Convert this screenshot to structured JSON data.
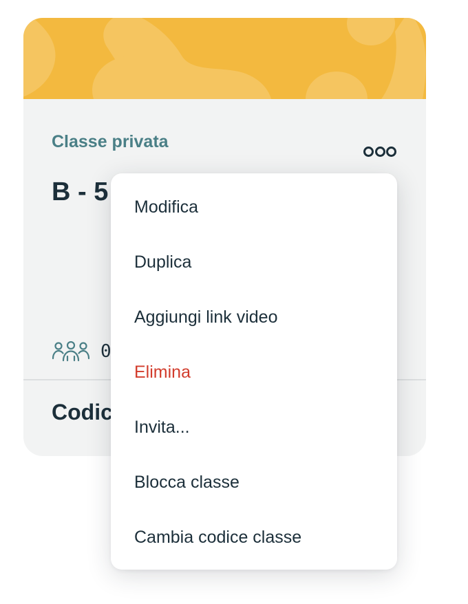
{
  "card": {
    "class_type": "Classe privata",
    "class_name": "B - 5",
    "students_count": "0",
    "code_label": "Codic",
    "banner_color": "#f3b93f",
    "background_color": "#f2f3f3"
  },
  "icons": {
    "more": "more-horizontal-icon",
    "students": "people-group-icon"
  },
  "menu": {
    "items": [
      {
        "label": "Modifica"
      },
      {
        "label": "Duplica"
      },
      {
        "label": "Aggiungi link video"
      },
      {
        "label": "Elimina",
        "color": "#d23c2c"
      },
      {
        "label": "Invita..."
      },
      {
        "label": "Blocca classe"
      },
      {
        "label": "Cambia codice classe"
      }
    ]
  },
  "colors": {
    "accent_teal": "#4a7f86",
    "text_dark": "#1c2f3a",
    "danger_red": "#d23c2c"
  }
}
